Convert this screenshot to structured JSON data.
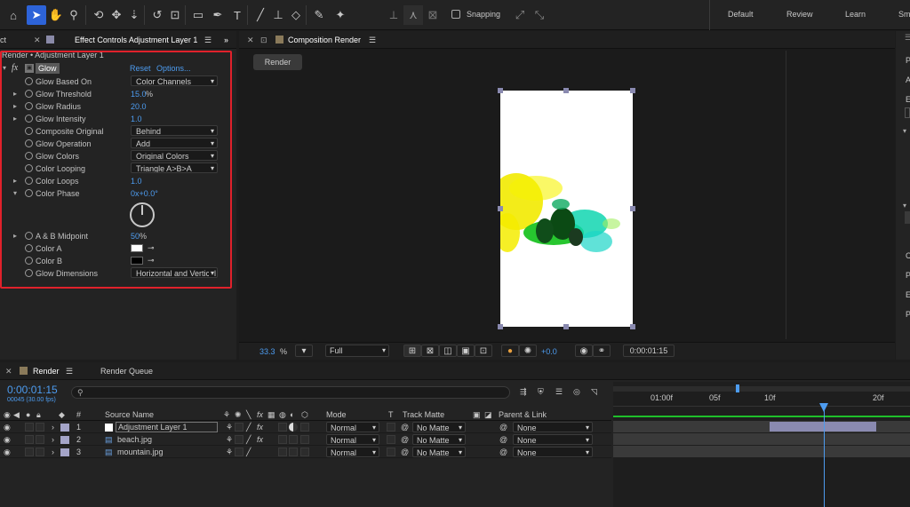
{
  "toolbar": {
    "snapping_label": "Snapping",
    "workspaces": [
      "Default",
      "Review",
      "Learn",
      "Sm"
    ]
  },
  "left_panel": {
    "partial_tab": "ct",
    "tab_title": "Effect Controls Adjustment Layer 1",
    "breadcrumb": "Render • Adjustment Layer 1",
    "effect_name": "Glow",
    "reset_label": "Reset",
    "options_label": "Options...",
    "props": {
      "based_on": {
        "label": "Glow Based On",
        "value": "Color Channels"
      },
      "threshold": {
        "label": "Glow Threshold",
        "value": "15.0",
        "unit": "%"
      },
      "radius": {
        "label": "Glow Radius",
        "value": "20.0"
      },
      "intensity": {
        "label": "Glow Intensity",
        "value": "1.0"
      },
      "composite": {
        "label": "Composite Original",
        "value": "Behind"
      },
      "operation": {
        "label": "Glow Operation",
        "value": "Add"
      },
      "colors": {
        "label": "Glow Colors",
        "value": "Original Colors"
      },
      "looping": {
        "label": "Color Looping",
        "value": "Triangle A>B>A"
      },
      "loops": {
        "label": "Color Loops",
        "value": "1.0"
      },
      "phase": {
        "label": "Color Phase",
        "value": "0x+0.0°"
      },
      "midpoint": {
        "label": "A & B Midpoint",
        "value": "50",
        "unit": "%"
      },
      "color_a": {
        "label": "Color A",
        "swatch": "#ffffff"
      },
      "color_b": {
        "label": "Color B",
        "swatch": "#000000"
      },
      "dimensions": {
        "label": "Glow Dimensions",
        "value": "Horizontal and Vertical"
      }
    }
  },
  "comp_panel": {
    "tab_title": "Composition Render",
    "render_button": "Render",
    "zoom": "33.3",
    "zoom_unit": "%",
    "resolution": "Full",
    "exposure": "+0.0",
    "timecode": "0:00:01:15"
  },
  "timeline": {
    "tab_render": "Render",
    "tab_queue": "Render Queue",
    "current_time": "0:00:01:15",
    "frame_info": "00045 (30.00 fps)",
    "headers": {
      "num": "#",
      "source": "Source Name",
      "mode": "Mode",
      "t": "T",
      "matte": "Track Matte",
      "parent": "Parent & Link"
    },
    "ruler_ticks": [
      "01:00f",
      "05f",
      "10f",
      "20f"
    ],
    "layers": [
      {
        "num": "1",
        "name": "Adjustment Layer 1",
        "mode": "Normal",
        "matte": "No Matte",
        "parent": "None",
        "fx": true
      },
      {
        "num": "2",
        "name": "beach.jpg",
        "mode": "Normal",
        "matte": "No Matte",
        "parent": "None",
        "fx": true
      },
      {
        "num": "3",
        "name": "mountain.jpg",
        "mode": "Normal",
        "matte": "No Matte",
        "parent": "None",
        "fx": false
      }
    ]
  },
  "right_panel": {
    "letters": [
      "P",
      "A",
      "E",
      "C",
      "P",
      "E",
      "P"
    ]
  }
}
